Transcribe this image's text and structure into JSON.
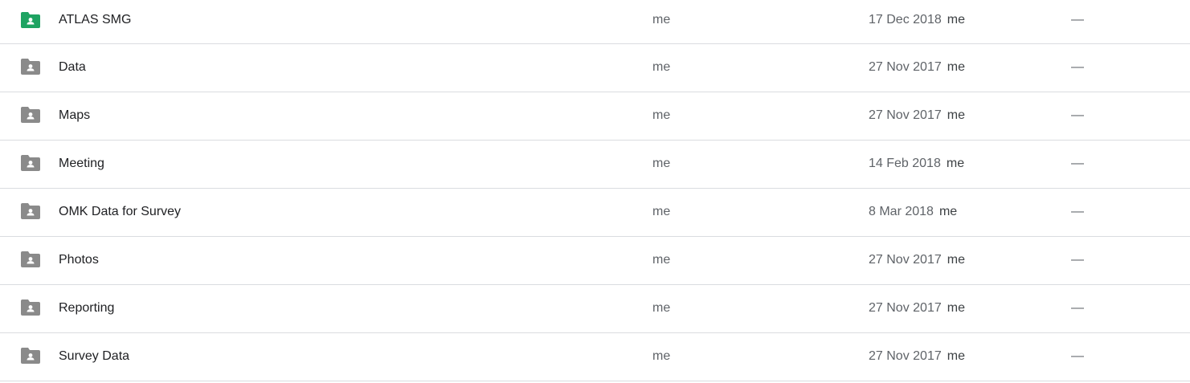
{
  "colors": {
    "shared_folder_green": "#0f9d58",
    "folder_grey": "#8a8a8a"
  },
  "files": [
    {
      "name": "ATLAS SMG",
      "owner": "me",
      "modified_date": "17 Dec 2018",
      "modified_by": "me",
      "size": "—",
      "icon": "shared-folder-icon",
      "icon_color": "#1ea362"
    },
    {
      "name": "Data",
      "owner": "me",
      "modified_date": "27 Nov 2017",
      "modified_by": "me",
      "size": "—",
      "icon": "shared-folder-icon",
      "icon_color": "#8a8a8a"
    },
    {
      "name": "Maps",
      "owner": "me",
      "modified_date": "27 Nov 2017",
      "modified_by": "me",
      "size": "—",
      "icon": "shared-folder-icon",
      "icon_color": "#8a8a8a"
    },
    {
      "name": "Meeting",
      "owner": "me",
      "modified_date": "14 Feb 2018",
      "modified_by": "me",
      "size": "—",
      "icon": "shared-folder-icon",
      "icon_color": "#8a8a8a"
    },
    {
      "name": "OMK Data for Survey",
      "owner": "me",
      "modified_date": "8 Mar 2018",
      "modified_by": "me",
      "size": "—",
      "icon": "shared-folder-icon",
      "icon_color": "#8a8a8a"
    },
    {
      "name": "Photos",
      "owner": "me",
      "modified_date": "27 Nov 2017",
      "modified_by": "me",
      "size": "—",
      "icon": "shared-folder-icon",
      "icon_color": "#8a8a8a"
    },
    {
      "name": "Reporting",
      "owner": "me",
      "modified_date": "27 Nov 2017",
      "modified_by": "me",
      "size": "—",
      "icon": "shared-folder-icon",
      "icon_color": "#8a8a8a"
    },
    {
      "name": "Survey Data",
      "owner": "me",
      "modified_date": "27 Nov 2017",
      "modified_by": "me",
      "size": "—",
      "icon": "shared-folder-icon",
      "icon_color": "#8a8a8a"
    }
  ]
}
